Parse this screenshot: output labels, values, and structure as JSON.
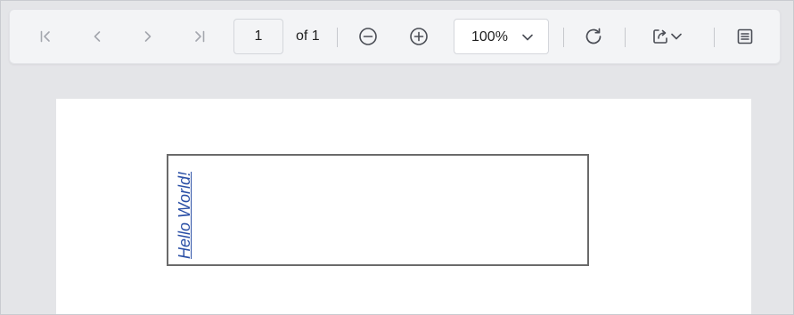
{
  "toolbar": {
    "first_page_icon": "first-page-icon",
    "prev_page_icon": "chevron-left-icon",
    "next_page_icon": "chevron-right-icon",
    "last_page_icon": "last-page-icon",
    "current_page": "1",
    "page_count_label": "of 1",
    "zoom_out_icon": "zoom-out-icon",
    "zoom_in_icon": "zoom-in-icon",
    "zoom_value": "100%",
    "refresh_icon": "refresh-icon",
    "export_icon": "export-icon",
    "sidebar_icon": "document-outline-icon"
  },
  "document": {
    "textbox_text": "Hello World!",
    "text_color": "#2a4fa6"
  },
  "colors": {
    "toolbar_bg": "#f3f4f6",
    "viewer_bg": "#e4e5e8",
    "page_bg": "#ffffff",
    "icon_enabled": "#4a4d55",
    "icon_disabled": "#a4a7ae"
  }
}
